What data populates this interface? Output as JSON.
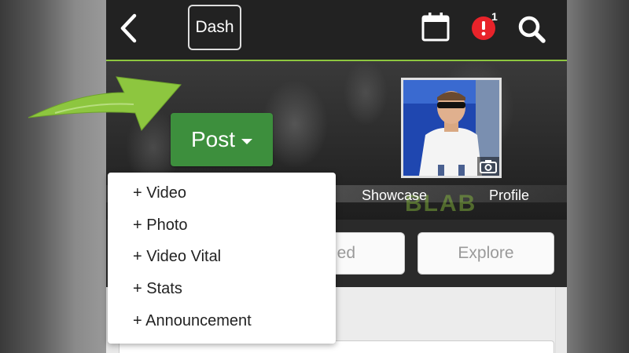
{
  "topbar": {
    "back_icon": "chevron-left-icon",
    "dash_label": "Dash",
    "calendar_icon": "calendar-icon",
    "alert_icon": "alert-icon",
    "alert_count": "1",
    "search_icon": "search-icon",
    "accent_color": "#8dc63f"
  },
  "hero": {
    "post_label": "Post",
    "showcase_label": "Showcase",
    "profile_label": "Profile",
    "brand_text": "BLAB",
    "camera_icon": "camera-icon"
  },
  "post_menu": {
    "items": [
      {
        "label": "+ Video"
      },
      {
        "label": "+ Photo"
      },
      {
        "label": "+ Video Vital"
      },
      {
        "label": "+ Stats"
      },
      {
        "label": "+ Announcement"
      }
    ]
  },
  "tabs": {
    "feed_label": "ed",
    "explore_label": "Explore"
  },
  "colors": {
    "post_button": "#3d8f3d",
    "arrow": "#8dc63f"
  }
}
